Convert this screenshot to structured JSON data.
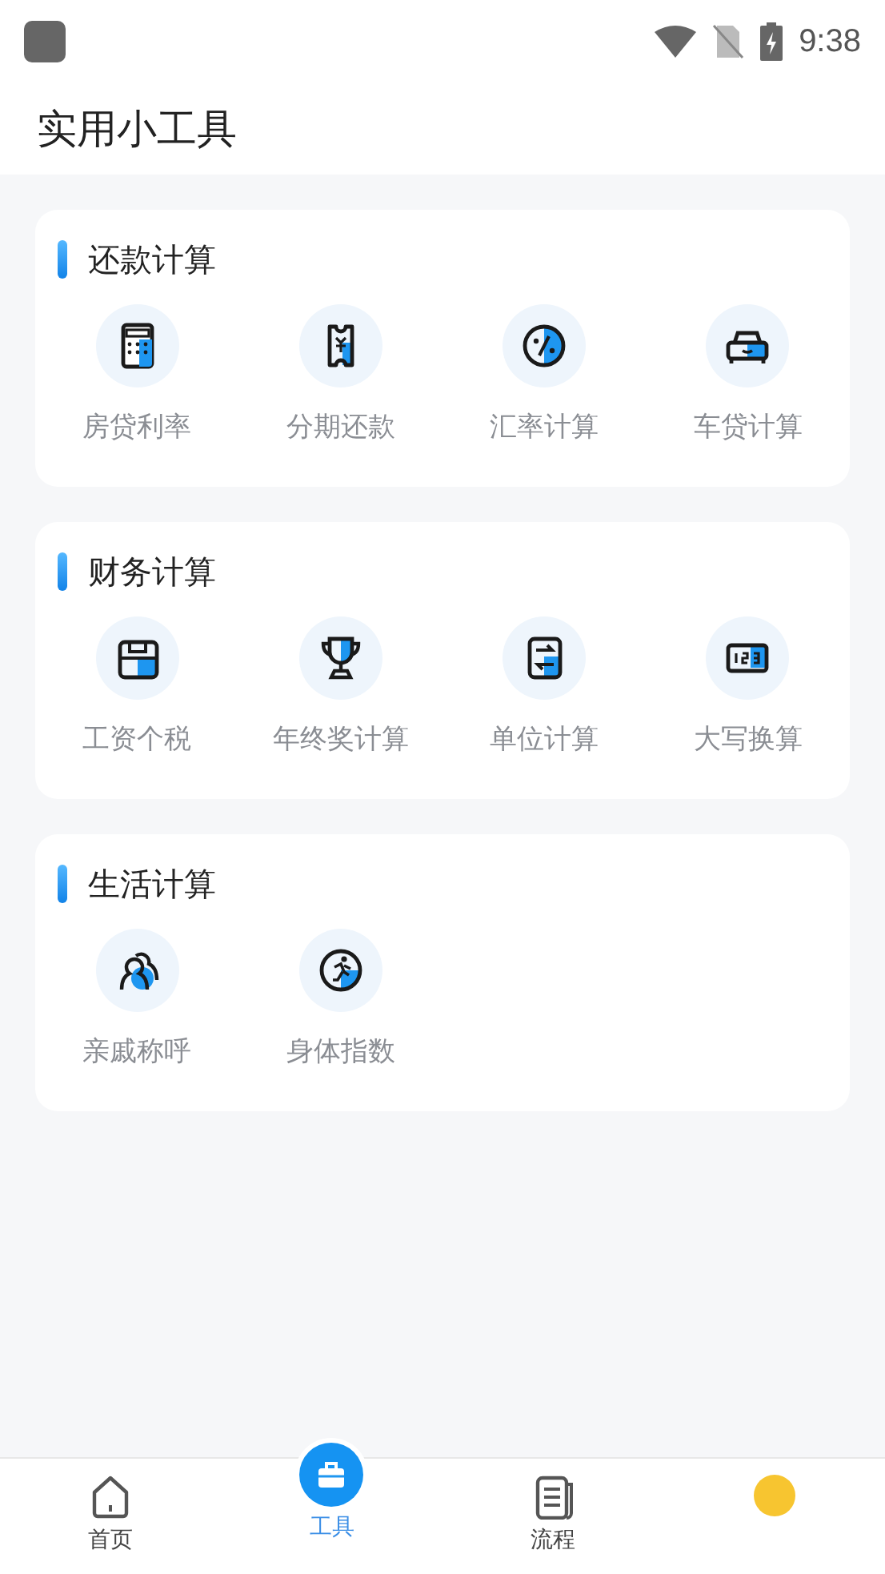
{
  "status_bar": {
    "time": "9:38"
  },
  "header": {
    "title": "实用小工具"
  },
  "sections": [
    {
      "title": "还款计算",
      "tools": [
        {
          "label": "房贷利率",
          "kind": "calculator"
        },
        {
          "label": "分期还款",
          "kind": "ticket"
        },
        {
          "label": "汇率计算",
          "kind": "percent"
        },
        {
          "label": "车贷计算",
          "kind": "car"
        }
      ]
    },
    {
      "title": "财务计算",
      "tools": [
        {
          "label": "工资个税",
          "kind": "wallet"
        },
        {
          "label": "年终奖计算",
          "kind": "trophy"
        },
        {
          "label": "单位计算",
          "kind": "swap"
        },
        {
          "label": "大写换算",
          "kind": "numbers"
        }
      ]
    },
    {
      "title": "生活计算",
      "tools": [
        {
          "label": "亲戚称呼",
          "kind": "people"
        },
        {
          "label": "身体指数",
          "kind": "runner"
        }
      ]
    }
  ],
  "bottom_nav": [
    {
      "label": "首页",
      "kind": "home",
      "selected": false
    },
    {
      "label": "工具",
      "kind": "toolbox",
      "selected": true
    },
    {
      "label": "流程",
      "kind": "document",
      "selected": false
    },
    {
      "kind": "sun",
      "selected": false
    }
  ]
}
